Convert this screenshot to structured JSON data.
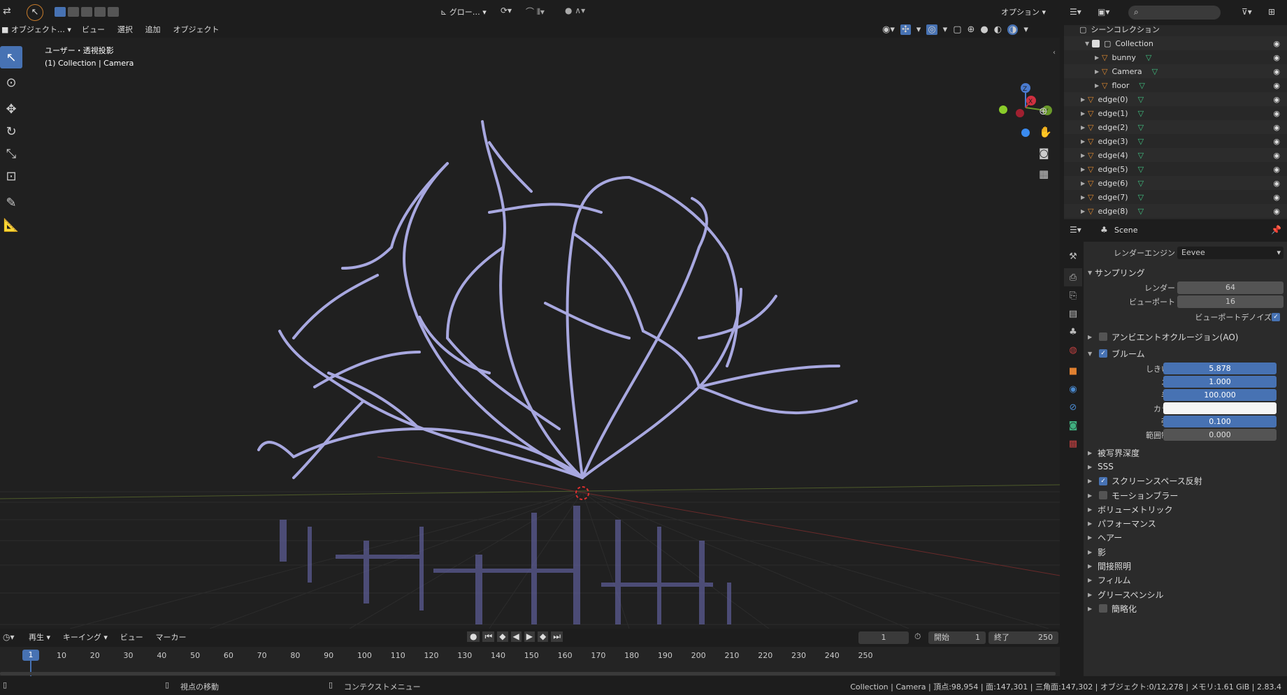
{
  "topbar": {
    "transform_pivot": "グロー…",
    "options": "オプション"
  },
  "viewport_header": {
    "mode": "オブジェクト…",
    "menus": [
      "ビュー",
      "選択",
      "追加",
      "オブジェクト"
    ]
  },
  "viewport": {
    "view_name": "ユーザー・透視投影",
    "collection_info": "(1) Collection | Camera",
    "gizmo_axes": [
      "Z",
      "X",
      "Y"
    ]
  },
  "outliner": {
    "root": "シーンコレクション",
    "collection": "Collection",
    "items": [
      {
        "name": "bunny",
        "indent": 2
      },
      {
        "name": "Camera",
        "indent": 2
      },
      {
        "name": "floor",
        "indent": 2
      },
      {
        "name": "edge(0)",
        "indent": 1
      },
      {
        "name": "edge(1)",
        "indent": 1
      },
      {
        "name": "edge(2)",
        "indent": 1
      },
      {
        "name": "edge(3)",
        "indent": 1
      },
      {
        "name": "edge(4)",
        "indent": 1
      },
      {
        "name": "edge(5)",
        "indent": 1
      },
      {
        "name": "edge(6)",
        "indent": 1
      },
      {
        "name": "edge(7)",
        "indent": 1
      },
      {
        "name": "edge(8)",
        "indent": 1
      }
    ]
  },
  "properties": {
    "scene_name": "Scene",
    "render_engine_label": "レンダーエンジン",
    "render_engine": "Eevee",
    "sampling": {
      "title": "サンプリング",
      "render_label": "レンダー",
      "render_value": "64",
      "viewport_label": "ビューポート",
      "viewport_value": "16",
      "denoise_label": "ビューポートデノイズ"
    },
    "ao_title": "アンビエントオクルージョン(AO)",
    "bloom": {
      "title": "ブルーム",
      "rows": [
        {
          "label": "しきい値",
          "value": "5.878"
        },
        {
          "label": "ニー",
          "value": "1.000"
        },
        {
          "label": "半径",
          "value": "100.000"
        },
        {
          "label": "カラー",
          "value": ""
        },
        {
          "label": "強度",
          "value": "0.100"
        },
        {
          "label": "範囲制限",
          "value": "0.000"
        }
      ]
    },
    "sections": [
      {
        "label": "被写界深度",
        "checkbox": null
      },
      {
        "label": "SSS",
        "checkbox": null
      },
      {
        "label": "スクリーンスペース反射",
        "checkbox": true
      },
      {
        "label": "モーションブラー",
        "checkbox": false
      },
      {
        "label": "ボリューメトリック",
        "checkbox": null
      },
      {
        "label": "パフォーマンス",
        "checkbox": null
      },
      {
        "label": "ヘアー",
        "checkbox": null
      },
      {
        "label": "影",
        "checkbox": null
      },
      {
        "label": "間接照明",
        "checkbox": null
      },
      {
        "label": "フィルム",
        "checkbox": null
      },
      {
        "label": "グリースペンシル",
        "checkbox": null
      },
      {
        "label": "簡略化",
        "checkbox": false
      }
    ]
  },
  "timeline": {
    "menus": [
      "再生",
      "キーイング",
      "ビュー",
      "マーカー"
    ],
    "current_frame": "1",
    "start_label": "開始",
    "start": "1",
    "end_label": "終了",
    "end": "250",
    "ticks": [
      "1",
      "10",
      "20",
      "30",
      "40",
      "50",
      "60",
      "70",
      "80",
      "90",
      "100",
      "110",
      "120",
      "130",
      "140",
      "150",
      "160",
      "170",
      "180",
      "190",
      "200",
      "210",
      "220",
      "230",
      "240",
      "250"
    ]
  },
  "statusbar": {
    "left_hint": "視点の移動",
    "mid_hint": "コンテクストメニュー",
    "info": "Collection | Camera | 頂点:98,954 | 面:147,301 | 三角面:147,302 | オブジェクト:0/12,278 | メモリ:1.61 GiB | 2.83.4"
  },
  "colors": {
    "accent": "#4772b3",
    "mesh": "#a8a8e0",
    "bg": "#1d1d1d"
  }
}
